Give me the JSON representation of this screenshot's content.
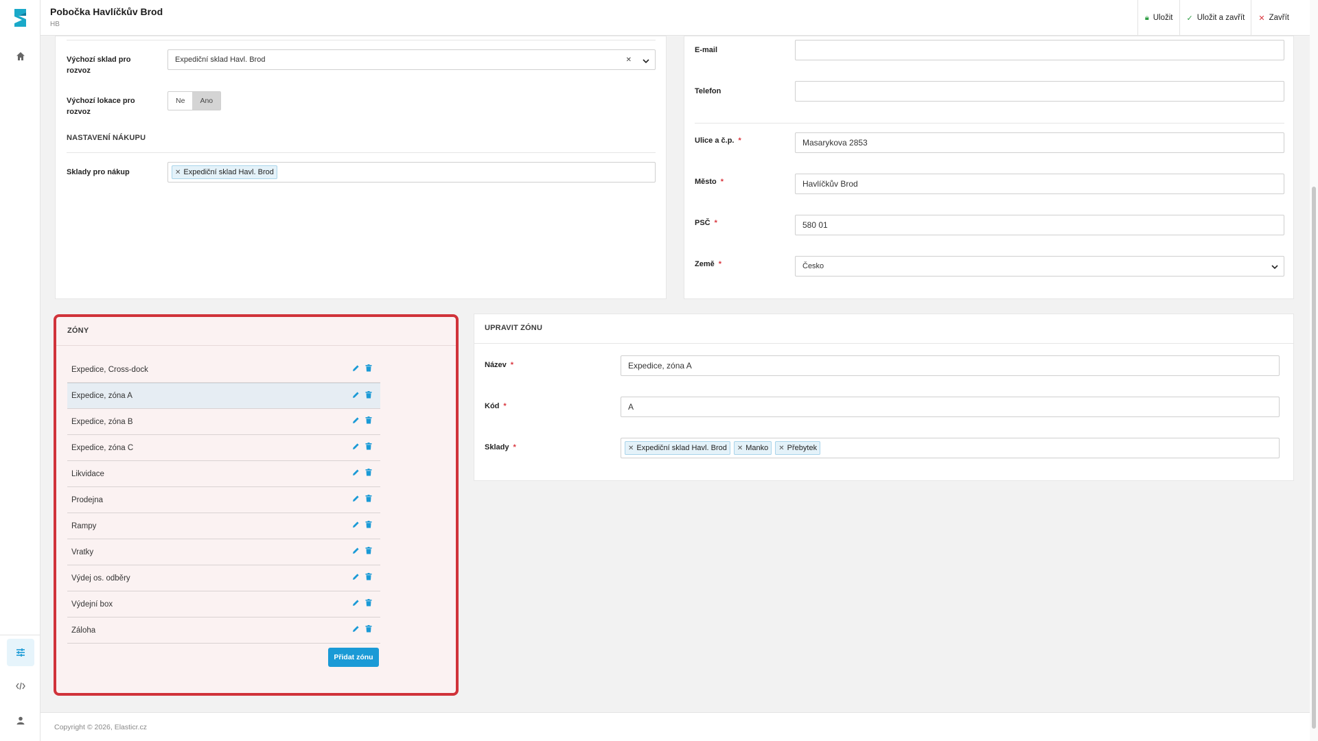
{
  "header": {
    "title": "Pobočka Havlíčkův Brod",
    "subtitle": "HB",
    "actions": {
      "save": "Uložit",
      "save_close": "Uložit a zavřít",
      "close": "Zavřít"
    }
  },
  "sidebar": {
    "icons": [
      "home-icon",
      "sliders-icon",
      "code-icon",
      "user-icon"
    ]
  },
  "left_card": {
    "default_warehouse_label": "Výchozí sklad pro rozvoz",
    "default_warehouse_value": "Expediční sklad Havl. Brod",
    "default_location_label": "Výchozí lokace pro rozvoz",
    "toggle_no": "Ne",
    "toggle_yes": "Ano",
    "toggle_selected": "Ano",
    "purchase_section": "NASTAVENÍ NÁKUPU",
    "purchase_label": "Sklady pro nákup",
    "purchase_tags": [
      "Expediční sklad Havl. Brod"
    ]
  },
  "right_card": {
    "email_label": "E-mail",
    "email_value": "",
    "phone_label": "Telefon",
    "phone_value": "",
    "street_label": "Ulice a č.p.",
    "street_value": "Masarykova 2853",
    "city_label": "Město",
    "city_value": "Havlíčkův Brod",
    "zip_label": "PSČ",
    "zip_value": "580 01",
    "country_label": "Země",
    "country_value": "Česko"
  },
  "zones": {
    "title": "ZÓNY",
    "items": [
      "Expedice, Cross-dock",
      "Expedice, zóna A",
      "Expedice, zóna B",
      "Expedice, zóna C",
      "Likvidace",
      "Prodejna",
      "Rampy",
      "Vratky",
      "Výdej os. odběry",
      "Výdejní box",
      "Záloha"
    ],
    "selected_index": 1,
    "add_button": "Přidat zónu"
  },
  "edit_zone": {
    "title": "UPRAVIT ZÓNU",
    "name_label": "Název",
    "name_value": "Expedice, zóna A",
    "code_label": "Kód",
    "code_value": "A",
    "warehouses_label": "Sklady",
    "warehouses_tags": [
      "Expediční sklad Havl. Brod",
      "Manko",
      "Přebytek"
    ]
  },
  "footer": {
    "copyright": "Copyright © 2026, Elasticr.cz"
  },
  "colors": {
    "accent": "#1a9ad6",
    "highlight_border": "#d0333a",
    "required": "#d9363e",
    "save_icon": "#2e9e44",
    "close_icon": "#d9363e"
  }
}
